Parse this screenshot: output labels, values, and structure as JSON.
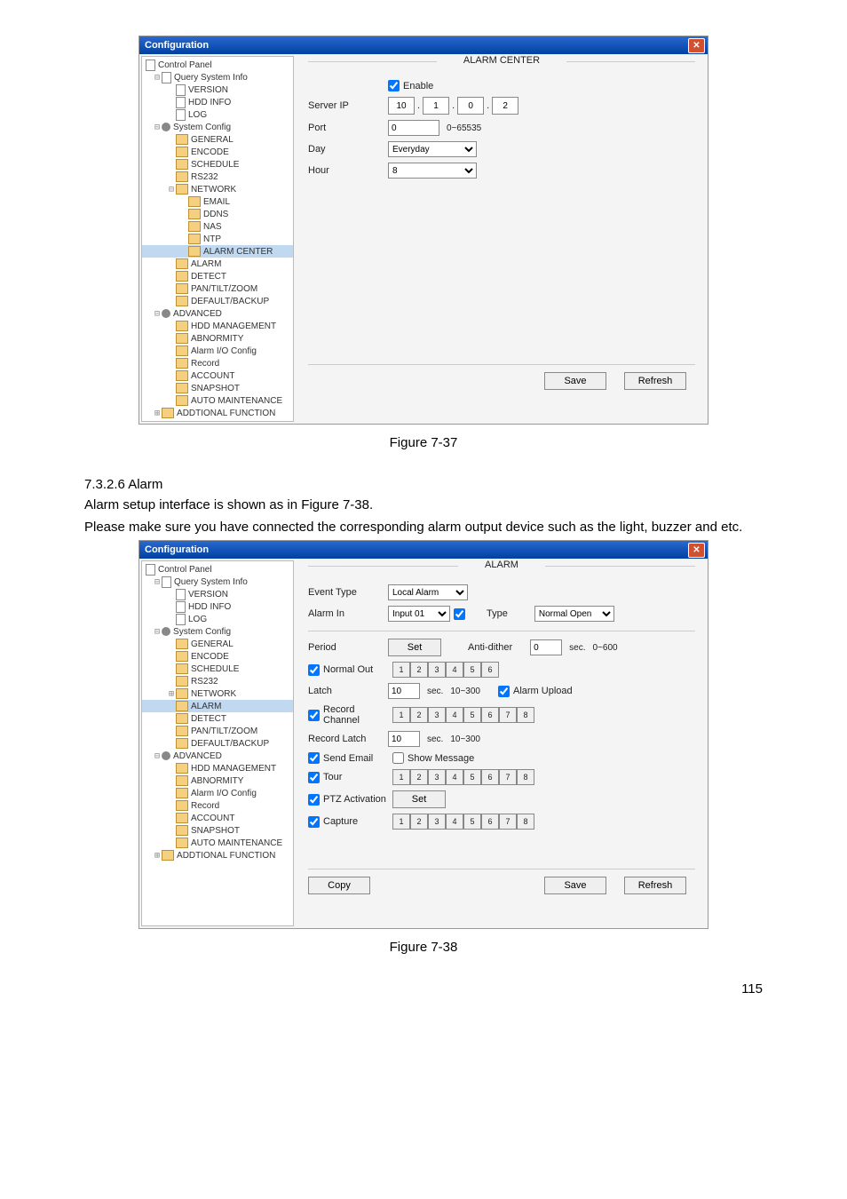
{
  "figure1": {
    "window_title": "Configuration",
    "heading": "ALARM CENTER",
    "tree_root": "Control Panel",
    "tree": {
      "qsi": "Query System Info",
      "version": "VERSION",
      "hddinfo": "HDD INFO",
      "log": "LOG",
      "sysconfig": "System Config",
      "general": "GENERAL",
      "encode": "ENCODE",
      "schedule": "SCHEDULE",
      "rs232": "RS232",
      "network": "NETWORK",
      "email": "EMAIL",
      "ddns": "DDNS",
      "nas": "NAS",
      "ntp": "NTP",
      "alarmcenter": "ALARM CENTER",
      "alarm": "ALARM",
      "detect": "DETECT",
      "ptz": "PAN/TILT/ZOOM",
      "defbk": "DEFAULT/BACKUP",
      "advanced": "ADVANCED",
      "hddmgmt": "HDD MANAGEMENT",
      "abnormity": "ABNORMITY",
      "alarmio": "Alarm I/O Config",
      "record": "Record",
      "account": "ACCOUNT",
      "snapshot": "SNAPSHOT",
      "automaint": "AUTO MAINTENANCE",
      "addfunc": "ADDTIONAL FUNCTION"
    },
    "form": {
      "enable_label": "Enable",
      "serverip_label": "Server IP",
      "ip": [
        "10",
        "1",
        "0",
        "2"
      ],
      "port_label": "Port",
      "port_value": "0",
      "port_hint": "0~65535",
      "day_label": "Day",
      "day_value": "Everyday",
      "hour_label": "Hour",
      "hour_value": "8"
    },
    "buttons": {
      "save": "Save",
      "refresh": "Refresh"
    },
    "caption": "Figure 7-37"
  },
  "section": {
    "number": "7.3.2.6  Alarm",
    "line1": "Alarm setup interface is shown as in Figure 7-38.",
    "line2": "Please make sure you have connected the corresponding alarm output device such as the light, buzzer and etc."
  },
  "figure2": {
    "window_title": "Configuration",
    "heading": "ALARM",
    "form": {
      "eventtype_label": "Event Type",
      "eventtype_value": "Local Alarm",
      "alarmin_label": "Alarm In",
      "alarmin_value": "Input 01",
      "type_label": "Type",
      "type_value": "Normal Open",
      "period_label": "Period",
      "period_btn": "Set",
      "antidither_label": "Anti-dither",
      "antidither_value": "0",
      "antidither_unit": "sec.",
      "antidither_hint": "0~600",
      "normalout_label": "Normal Out",
      "normalout_ch": [
        "1",
        "2",
        "3",
        "4",
        "5",
        "6"
      ],
      "latch_label": "Latch",
      "latch_value": "10",
      "latch_unit": "sec.",
      "latch_hint": "10~300",
      "alarmupload_label": "Alarm Upload",
      "recordch_label": "Record Channel",
      "recordch": [
        "1",
        "2",
        "3",
        "4",
        "5",
        "6",
        "7",
        "8"
      ],
      "recordlatch_label": "Record Latch",
      "recordlatch_value": "10",
      "recordlatch_unit": "sec.",
      "recordlatch_hint": "10~300",
      "sendemail_label": "Send Email",
      "showmsg_label": "Show Message",
      "tour_label": "Tour",
      "tour_ch": [
        "1",
        "2",
        "3",
        "4",
        "5",
        "6",
        "7",
        "8"
      ],
      "ptzact_label": "PTZ Activation",
      "ptzact_btn": "Set",
      "capture_label": "Capture",
      "capture_ch": [
        "1",
        "2",
        "3",
        "4",
        "5",
        "6",
        "7",
        "8"
      ]
    },
    "buttons": {
      "copy": "Copy",
      "save": "Save",
      "refresh": "Refresh"
    },
    "caption": "Figure 7-38"
  },
  "page_number": "115"
}
